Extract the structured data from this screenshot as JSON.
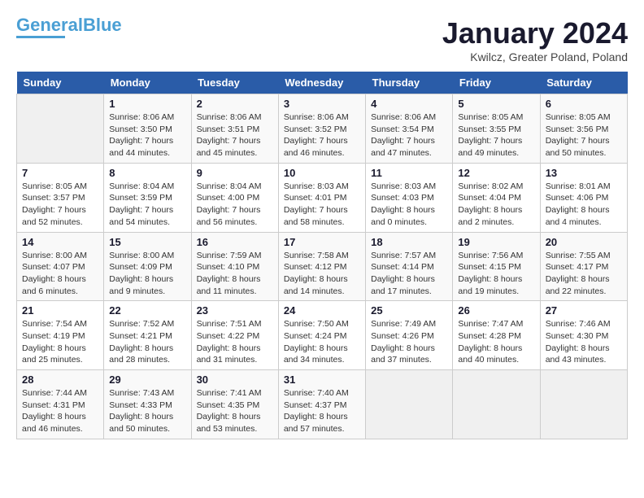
{
  "header": {
    "logo_line1": "General",
    "logo_line2": "Blue",
    "title": "January 2024",
    "subtitle": "Kwilcz, Greater Poland, Poland"
  },
  "weekdays": [
    "Sunday",
    "Monday",
    "Tuesday",
    "Wednesday",
    "Thursday",
    "Friday",
    "Saturday"
  ],
  "weeks": [
    [
      {
        "day": "",
        "info": ""
      },
      {
        "day": "1",
        "info": "Sunrise: 8:06 AM\nSunset: 3:50 PM\nDaylight: 7 hours\nand 44 minutes."
      },
      {
        "day": "2",
        "info": "Sunrise: 8:06 AM\nSunset: 3:51 PM\nDaylight: 7 hours\nand 45 minutes."
      },
      {
        "day": "3",
        "info": "Sunrise: 8:06 AM\nSunset: 3:52 PM\nDaylight: 7 hours\nand 46 minutes."
      },
      {
        "day": "4",
        "info": "Sunrise: 8:06 AM\nSunset: 3:54 PM\nDaylight: 7 hours\nand 47 minutes."
      },
      {
        "day": "5",
        "info": "Sunrise: 8:05 AM\nSunset: 3:55 PM\nDaylight: 7 hours\nand 49 minutes."
      },
      {
        "day": "6",
        "info": "Sunrise: 8:05 AM\nSunset: 3:56 PM\nDaylight: 7 hours\nand 50 minutes."
      }
    ],
    [
      {
        "day": "7",
        "info": "Sunrise: 8:05 AM\nSunset: 3:57 PM\nDaylight: 7 hours\nand 52 minutes."
      },
      {
        "day": "8",
        "info": "Sunrise: 8:04 AM\nSunset: 3:59 PM\nDaylight: 7 hours\nand 54 minutes."
      },
      {
        "day": "9",
        "info": "Sunrise: 8:04 AM\nSunset: 4:00 PM\nDaylight: 7 hours\nand 56 minutes."
      },
      {
        "day": "10",
        "info": "Sunrise: 8:03 AM\nSunset: 4:01 PM\nDaylight: 7 hours\nand 58 minutes."
      },
      {
        "day": "11",
        "info": "Sunrise: 8:03 AM\nSunset: 4:03 PM\nDaylight: 8 hours\nand 0 minutes."
      },
      {
        "day": "12",
        "info": "Sunrise: 8:02 AM\nSunset: 4:04 PM\nDaylight: 8 hours\nand 2 minutes."
      },
      {
        "day": "13",
        "info": "Sunrise: 8:01 AM\nSunset: 4:06 PM\nDaylight: 8 hours\nand 4 minutes."
      }
    ],
    [
      {
        "day": "14",
        "info": "Sunrise: 8:00 AM\nSunset: 4:07 PM\nDaylight: 8 hours\nand 6 minutes."
      },
      {
        "day": "15",
        "info": "Sunrise: 8:00 AM\nSunset: 4:09 PM\nDaylight: 8 hours\nand 9 minutes."
      },
      {
        "day": "16",
        "info": "Sunrise: 7:59 AM\nSunset: 4:10 PM\nDaylight: 8 hours\nand 11 minutes."
      },
      {
        "day": "17",
        "info": "Sunrise: 7:58 AM\nSunset: 4:12 PM\nDaylight: 8 hours\nand 14 minutes."
      },
      {
        "day": "18",
        "info": "Sunrise: 7:57 AM\nSunset: 4:14 PM\nDaylight: 8 hours\nand 17 minutes."
      },
      {
        "day": "19",
        "info": "Sunrise: 7:56 AM\nSunset: 4:15 PM\nDaylight: 8 hours\nand 19 minutes."
      },
      {
        "day": "20",
        "info": "Sunrise: 7:55 AM\nSunset: 4:17 PM\nDaylight: 8 hours\nand 22 minutes."
      }
    ],
    [
      {
        "day": "21",
        "info": "Sunrise: 7:54 AM\nSunset: 4:19 PM\nDaylight: 8 hours\nand 25 minutes."
      },
      {
        "day": "22",
        "info": "Sunrise: 7:52 AM\nSunset: 4:21 PM\nDaylight: 8 hours\nand 28 minutes."
      },
      {
        "day": "23",
        "info": "Sunrise: 7:51 AM\nSunset: 4:22 PM\nDaylight: 8 hours\nand 31 minutes."
      },
      {
        "day": "24",
        "info": "Sunrise: 7:50 AM\nSunset: 4:24 PM\nDaylight: 8 hours\nand 34 minutes."
      },
      {
        "day": "25",
        "info": "Sunrise: 7:49 AM\nSunset: 4:26 PM\nDaylight: 8 hours\nand 37 minutes."
      },
      {
        "day": "26",
        "info": "Sunrise: 7:47 AM\nSunset: 4:28 PM\nDaylight: 8 hours\nand 40 minutes."
      },
      {
        "day": "27",
        "info": "Sunrise: 7:46 AM\nSunset: 4:30 PM\nDaylight: 8 hours\nand 43 minutes."
      }
    ],
    [
      {
        "day": "28",
        "info": "Sunrise: 7:44 AM\nSunset: 4:31 PM\nDaylight: 8 hours\nand 46 minutes."
      },
      {
        "day": "29",
        "info": "Sunrise: 7:43 AM\nSunset: 4:33 PM\nDaylight: 8 hours\nand 50 minutes."
      },
      {
        "day": "30",
        "info": "Sunrise: 7:41 AM\nSunset: 4:35 PM\nDaylight: 8 hours\nand 53 minutes."
      },
      {
        "day": "31",
        "info": "Sunrise: 7:40 AM\nSunset: 4:37 PM\nDaylight: 8 hours\nand 57 minutes."
      },
      {
        "day": "",
        "info": ""
      },
      {
        "day": "",
        "info": ""
      },
      {
        "day": "",
        "info": ""
      }
    ]
  ]
}
